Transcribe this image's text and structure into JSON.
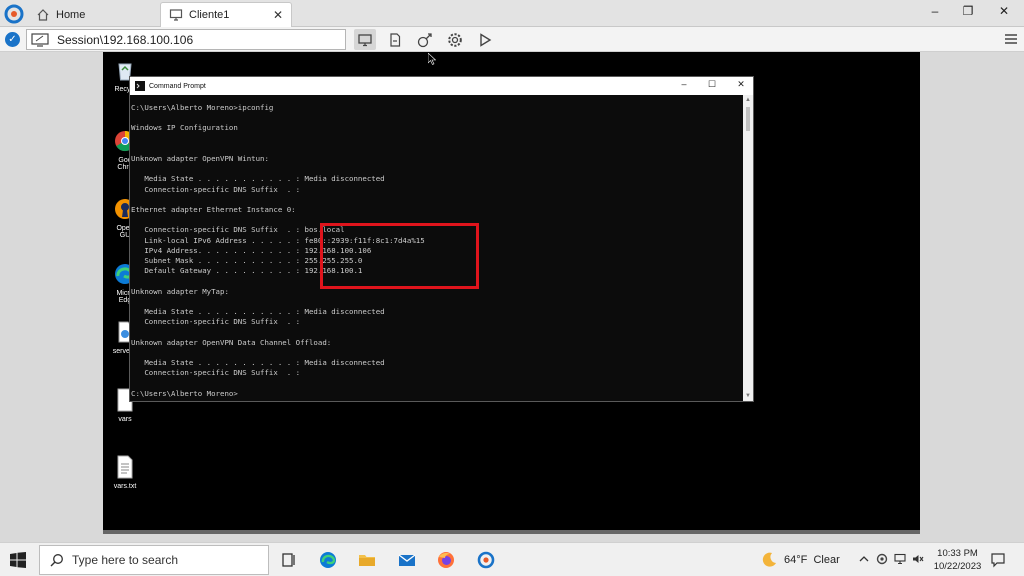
{
  "tabs": [
    {
      "label": "Home",
      "icon": "home-icon"
    },
    {
      "label": "Cliente1",
      "icon": "monitor-icon"
    }
  ],
  "address": {
    "session": "Session\\192.168.100.106"
  },
  "desktop": {
    "icons": [
      {
        "label": "Recycl",
        "icon": "recycle-bin-icon"
      },
      {
        "label": "Goo\nChro",
        "icon": "chrome-icon"
      },
      {
        "label": "Open\nGU",
        "icon": "openvpn-gui-icon"
      },
      {
        "label": "Micro\nEdg",
        "icon": "edge-icon"
      },
      {
        "label": "server.c",
        "icon": "file-icon"
      },
      {
        "label": "vars",
        "icon": "file-icon"
      },
      {
        "label": "vars.txt",
        "icon": "text-file-icon"
      }
    ]
  },
  "cmd": {
    "title": "Command Prompt",
    "lines": [
      "C:\\Users\\Alberto Moreno>ipconfig",
      "",
      "Windows IP Configuration",
      "",
      "",
      "Unknown adapter OpenVPN Wintun:",
      "",
      "   Media State . . . . . . . . . . . : Media disconnected",
      "   Connection-specific DNS Suffix  . :",
      "",
      "Ethernet adapter Ethernet Instance 0:",
      "",
      "   Connection-specific DNS Suffix  . : bos.local",
      "   Link-local IPv6 Address . . . . . : fe80::2939:f11f:8c1:7d4a%15",
      "   IPv4 Address. . . . . . . . . . . : 192.168.100.106",
      "   Subnet Mask . . . . . . . . . . . : 255.255.255.0",
      "   Default Gateway . . . . . . . . . : 192.168.100.1",
      "",
      "Unknown adapter MyTap:",
      "",
      "   Media State . . . . . . . . . . . : Media disconnected",
      "   Connection-specific DNS Suffix  . :",
      "",
      "Unknown adapter OpenVPN Data Channel Offload:",
      "",
      "   Media State . . . . . . . . . . . : Media disconnected",
      "   Connection-specific DNS Suffix  . :",
      "",
      "C:\\Users\\Alberto Moreno>"
    ],
    "highlight_color": "#e0141c"
  },
  "taskbar": {
    "search_placeholder": "Type here to search",
    "apps": [
      "task-view-icon",
      "edge-icon",
      "file-explorer-icon",
      "mail-icon",
      "firefox-icon",
      "remote-client-icon"
    ],
    "weather_temp": "64°F",
    "weather_cond": "Clear",
    "time": "10:33 PM",
    "date": "10/22/2023"
  },
  "colors": {
    "accent": "#1a73c8",
    "desktop_bg": "#000000",
    "terminal_bg": "#0c0c0c"
  }
}
